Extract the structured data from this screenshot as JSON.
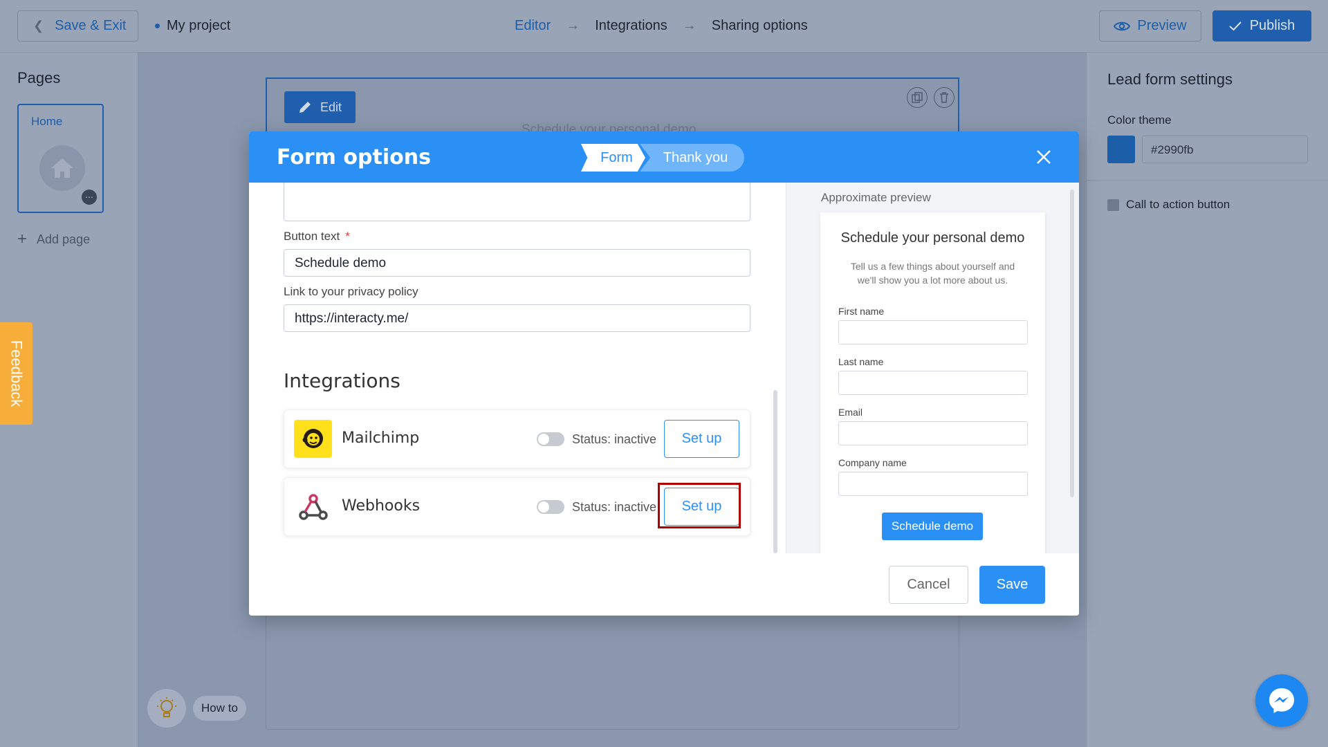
{
  "topbar": {
    "save_exit_label": "Save & Exit",
    "project_name": "My project",
    "steps": [
      "Editor",
      "Integrations",
      "Sharing options"
    ],
    "preview_label": "Preview",
    "publish_label": "Publish"
  },
  "sidebar_left": {
    "title": "Pages",
    "page_label": "Home",
    "add_page_label": "Add page"
  },
  "feedback_label": "Feedback",
  "howto_label": "How to",
  "canvas": {
    "edit_label": "Edit",
    "ghost_text": "Schedule your personal demo"
  },
  "sidebar_right": {
    "title": "Lead form settings",
    "color_theme_label": "Color theme",
    "color_value": "#2990fb",
    "cta_label": "Call to action button"
  },
  "modal": {
    "title": "Form options",
    "tabs": [
      "Form",
      "Thank you"
    ],
    "button_text_label": "Button text",
    "button_text_value": "Schedule demo",
    "privacy_label": "Link to your privacy policy",
    "privacy_value": "https://interacty.me/",
    "integrations_title": "Integrations",
    "integrations": [
      {
        "name": "Mailchimp",
        "status": "Status: inactive",
        "button": "Set up",
        "icon": "mailchimp-icon"
      },
      {
        "name": "Webhooks",
        "status": "Status: inactive",
        "button": "Set up",
        "icon": "webhooks-icon"
      }
    ],
    "preview": {
      "title": "Approximate preview",
      "heading": "Schedule your personal demo",
      "subtext": "Tell us a few things about yourself and we'll show you a lot more about us.",
      "fields": [
        "First name",
        "Last name",
        "Email",
        "Company name"
      ],
      "button": "Schedule demo"
    },
    "cancel_label": "Cancel",
    "save_label": "Save"
  },
  "colors": {
    "accent": "#2b90f5",
    "overlay_bg": "#8a97ad",
    "feedback": "#f7ad3a",
    "highlight": "#b00000"
  }
}
